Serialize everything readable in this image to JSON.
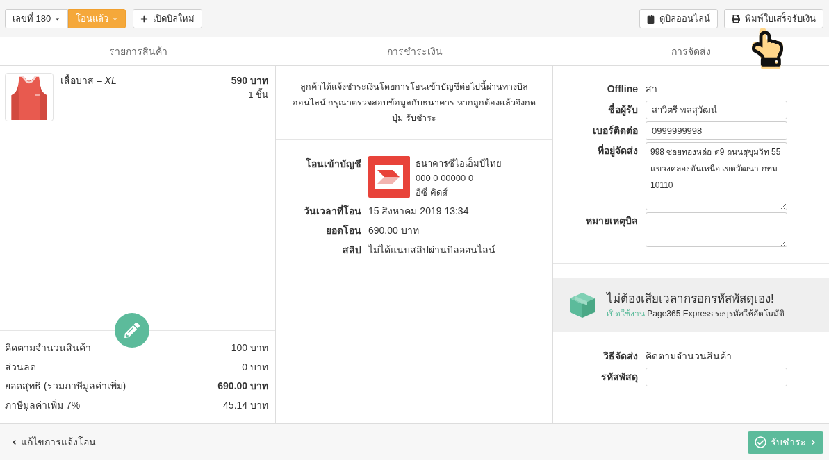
{
  "toolbar": {
    "number_dropdown": "เลขที่ 180",
    "status_dropdown": "โอนแล้ว",
    "new_bill_button": "เปิดบิลใหม่",
    "view_bill_button": "ดูบิลออนไลน์",
    "print_button": "พิมพ์ใบเสร็จรับเงิน"
  },
  "columns": [
    {
      "title": "รายการสินค้า"
    },
    {
      "title": "การชำระเงิน"
    },
    {
      "title": "การจัดส่ง"
    }
  ],
  "products": [
    {
      "name": "เสื้อบาส – *XL*",
      "price": "590 บาท",
      "quantity": "1 ชิ้น"
    }
  ],
  "summary": [
    {
      "label": "คิดตามจำนวนสินค้า",
      "value": "100 บาท",
      "bold": false
    },
    {
      "label": "ส่วนลด",
      "value": "0 บาท",
      "bold": false
    },
    {
      "label": "ยอดสุทธิ (รวมภาษีมูลค่าเพิ่ม)",
      "value": "690.00 บาท",
      "bold": true
    },
    {
      "label": "ภาษีมูลค่าเพิ่ม 7%",
      "value": "45.14 บาท",
      "bold": false
    }
  ],
  "payment": {
    "notice": "ลูกค้าได้แจ้งชำระเงินโดยการโอนเข้าบัญชีต่อไปนี้ผ่านทางบิลออนไลน์ กรุณาตรวจสอบข้อมูลกับธนาคาร หากถูกต้องแล้วจึงกดปุ่ม รับชำระ",
    "details": [
      {
        "kind": "bank",
        "label": "โอนเข้าบัญชี",
        "lines": [
          "ธนาคารซีไอเอ็มบีไทย",
          "000 0 00000 0",
          "อีซี่ คิดส์"
        ]
      },
      {
        "kind": "text",
        "label": "วันเวลาที่โอน",
        "value": "15 สิงหาคม 2019 13:34"
      },
      {
        "kind": "text",
        "label": "ยอดโอน",
        "value": "690.00 บาท"
      },
      {
        "kind": "text",
        "label": "สลิป",
        "value": "ไม่ได้แนบสลิปผ่านบิลออนไลน์"
      }
    ]
  },
  "shipping": {
    "fields": [
      {
        "kind": "text",
        "label": "Offline",
        "value": "สา"
      },
      {
        "kind": "input",
        "label": "ชื่อผู้รับ",
        "value": "สาวิตรี พลสุวัฒน์"
      },
      {
        "kind": "input",
        "label": "เบอร์ติดต่อ",
        "value": "0999999998"
      },
      {
        "kind": "address",
        "label": "ที่อยู่จัดส่ง",
        "value": "998 ซอยทองหล่อ ต9 ถนนสุขุมวิท 55 แขวงคลองตันเหนือ เขตวัฒนา กทม 10110"
      },
      {
        "kind": "note",
        "label": "หมายเหตุบิล"
      }
    ],
    "promo": {
      "title": "ไม่ต้องเสียเวลากรอกรหัสพัสดุเอง!",
      "link": "เปิดใช้งาน",
      "text": "Page365 Express ระบุรหัสให้อัตโนมัติ"
    },
    "delivery": [
      {
        "kind": "text",
        "label": "วิธีจัดส่ง",
        "value": "คิดตามจำนวนสินค้า"
      },
      {
        "kind": "input",
        "label": "รหัสพัสดุ"
      }
    ]
  },
  "footer": {
    "back_link": "แก้ไขการแจ้งโอน",
    "confirm_button": "รับชำระ"
  }
}
